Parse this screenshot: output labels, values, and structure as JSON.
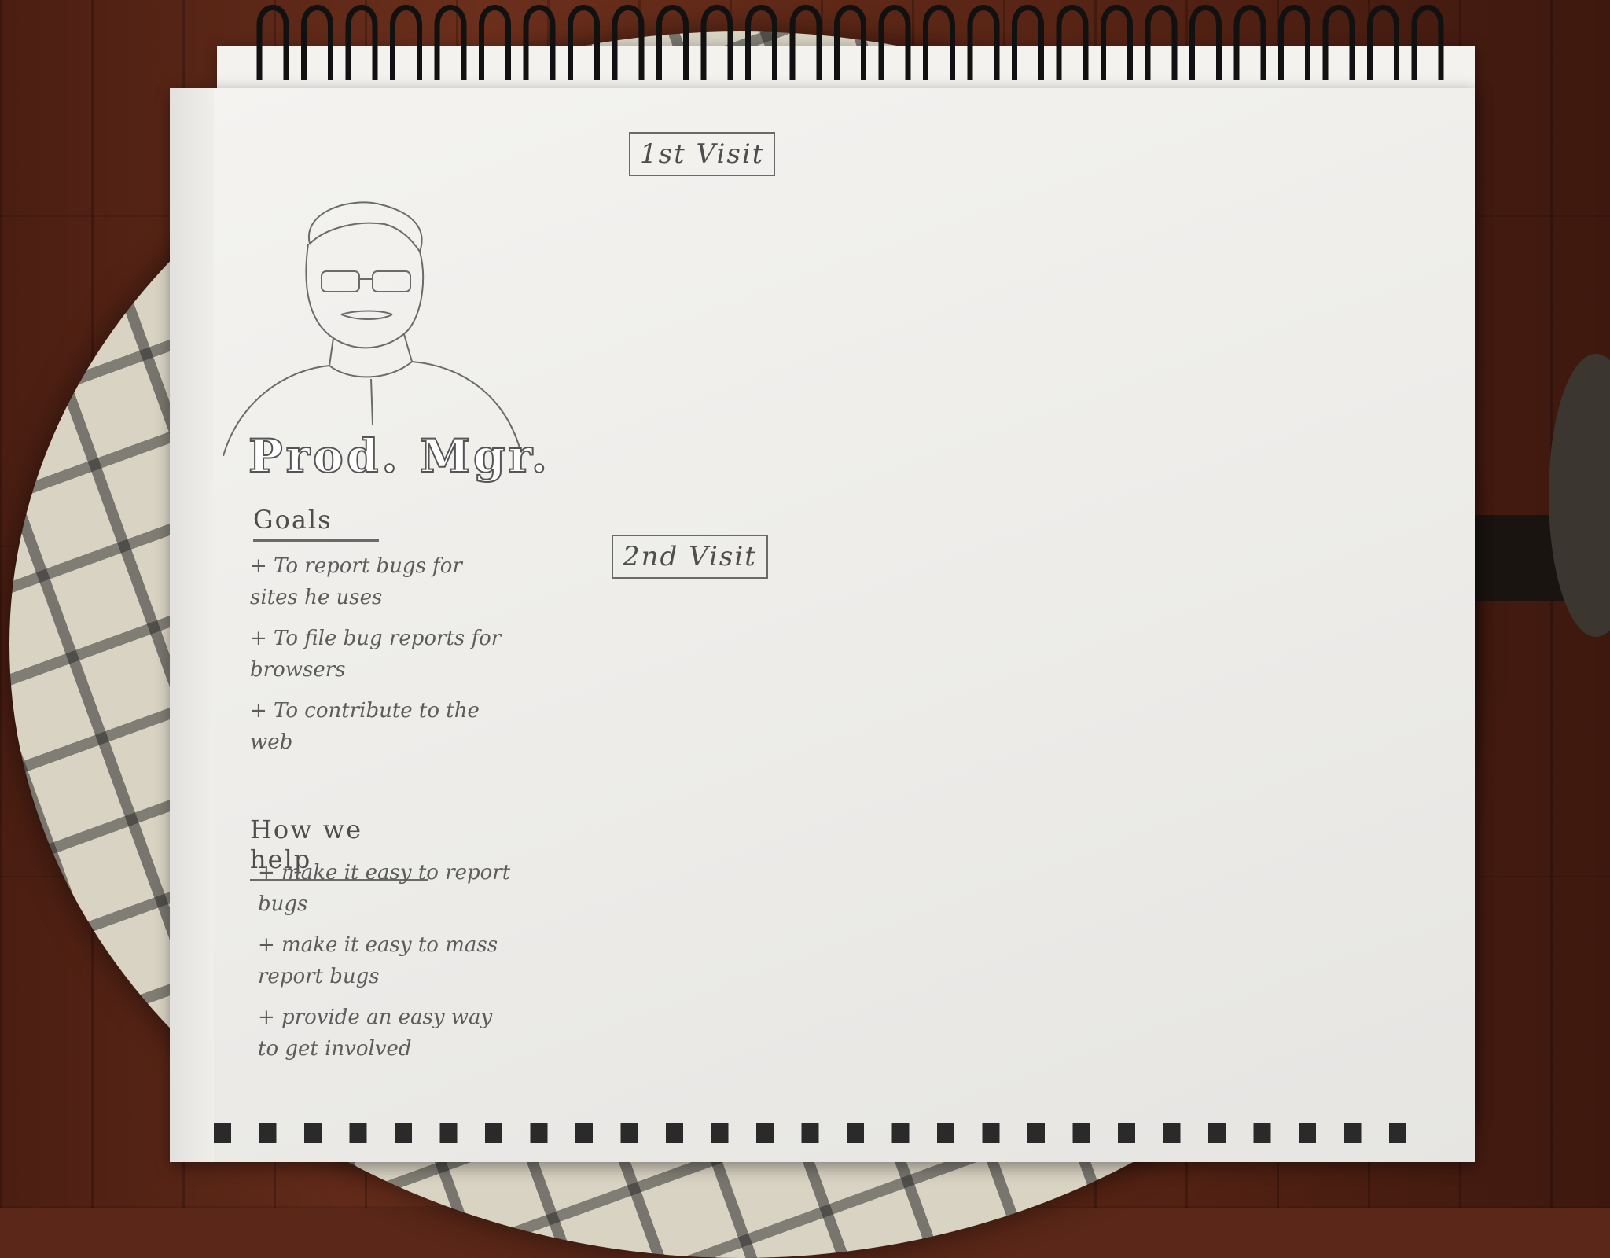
{
  "sketch": {
    "first_visit": "1st Visit",
    "second_visit": "2nd Visit",
    "persona_title": "Prod. Mgr.",
    "goals": {
      "heading": "Goals",
      "items": [
        "+ To report bugs for sites he uses",
        "+ To file bug reports for browsers",
        "+ To contribute to the web"
      ]
    },
    "how_we_help": {
      "heading": "How we help",
      "items": [
        "+ make it easy to report bugs",
        "+ make it easy to mass report bugs",
        "+ provide an easy way to get involved"
      ]
    }
  }
}
